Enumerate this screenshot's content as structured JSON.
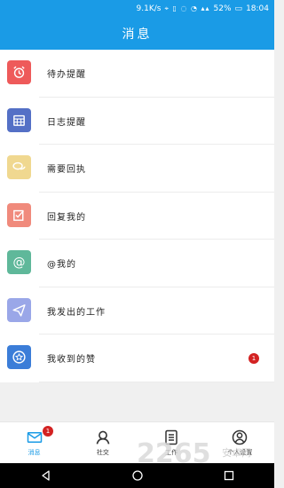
{
  "status_bar": {
    "speed": "9.1K/s",
    "battery": "52%",
    "time": "18:04"
  },
  "header": {
    "title": "消息"
  },
  "list": [
    {
      "label": "待办提醒",
      "icon": "alarm-clock-icon",
      "color": "#ee5a5a"
    },
    {
      "label": "日志提醒",
      "icon": "calendar-icon",
      "color": "#5470c6"
    },
    {
      "label": "需要回执",
      "icon": "chat-bubbles-icon",
      "color": "#f0d890"
    },
    {
      "label": "回复我的",
      "icon": "edit-check-icon",
      "color": "#f08a7c"
    },
    {
      "label": "@我的",
      "icon": "at-sign-icon",
      "color": "#5fb89a"
    },
    {
      "label": "我发出的工作",
      "icon": "paper-plane-icon",
      "color": "#9aa7e8"
    },
    {
      "label": "我收到的赞",
      "icon": "star-badge-icon",
      "color": "#3b7dd8",
      "badge": "1"
    }
  ],
  "tabbar": {
    "tabs": [
      {
        "label": "消息",
        "icon": "envelope-icon",
        "badge": "1",
        "active": true
      },
      {
        "label": "社交",
        "icon": "people-icon"
      },
      {
        "label": "工作",
        "icon": "document-list-icon"
      },
      {
        "label": "个人设置",
        "icon": "user-profile-icon"
      }
    ]
  },
  "colors": {
    "accent": "#1a9be6",
    "badge": "#d32222"
  },
  "watermark": "2265安卓网"
}
